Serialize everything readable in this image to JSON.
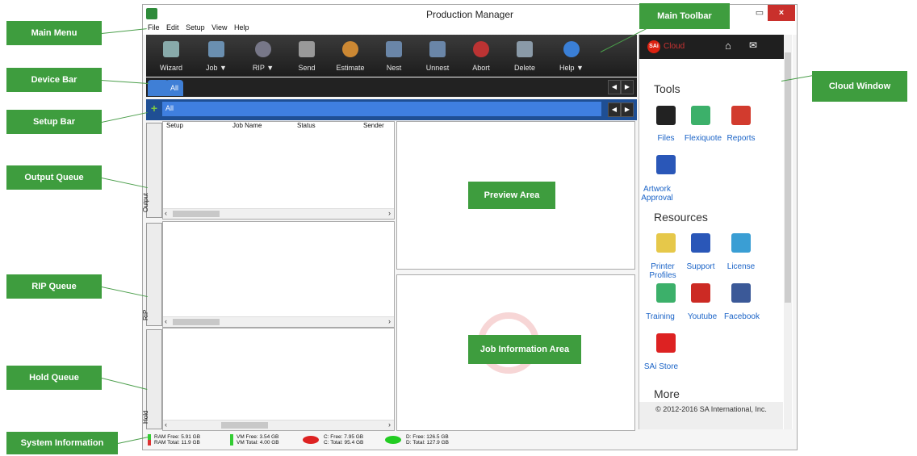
{
  "window": {
    "title": "Production Manager",
    "min": "▭",
    "close": "×"
  },
  "menu": [
    "File",
    "Edit",
    "Setup",
    "View",
    "Help"
  ],
  "toolbar": [
    "Wizard",
    "Job ▼",
    "RIP ▼",
    "Send",
    "Estimate",
    "Nest",
    "Unnest",
    "Abort",
    "Delete",
    "Help ▼"
  ],
  "device_tab": "All",
  "setup_tab": "All",
  "output_queue": {
    "tab": "Output",
    "columns": [
      "Setup",
      "Job Name",
      "Status",
      "Sender"
    ]
  },
  "rip_queue": {
    "tab": "RIP"
  },
  "hold_queue": {
    "tab": "Hold"
  },
  "system": {
    "ram_free": "RAM Free: 5.91 GB",
    "ram_total": "RAM Total: 11.9 GB",
    "vm_free": "VM Free: 3.54 GB",
    "vm_total": "VM Total: 4.00 GB",
    "c_free": "C: Free: 7.95 GB",
    "c_total": "C: Total: 95.4 GB",
    "d_free": "D: Free: 126.5 GB",
    "d_total": "D: Total: 127.9 GB"
  },
  "cloud": {
    "brand": "SAi",
    "brand_text": "Cloud",
    "tools_title": "Tools",
    "tools": [
      "Files",
      "Flexiquote",
      "Reports",
      "Artwork Approval"
    ],
    "resources_title": "Resources",
    "resources": [
      "Printer Profiles",
      "Support",
      "License",
      "Training",
      "Youtube",
      "Facebook",
      "SAi Store"
    ],
    "more_title": "More",
    "copyright": "© 2012-2016 SA International, Inc."
  },
  "callouts": {
    "main_menu": "Main Menu",
    "device_bar": "Device Bar",
    "setup_bar": "Setup Bar",
    "output_queue": "Output Queue",
    "rip_queue": "RIP Queue",
    "hold_queue": "Hold Queue",
    "system_info": "System Information",
    "main_toolbar": "Main Toolbar",
    "cloud_window": "Cloud Window",
    "preview_area": "Preview Area",
    "job_info_area": "Job Information Area"
  },
  "colors": {
    "callout_green": "#3e9d3e",
    "toolbar_dark": "#2a2a2a",
    "setup_blue": "#3f7fe0"
  }
}
